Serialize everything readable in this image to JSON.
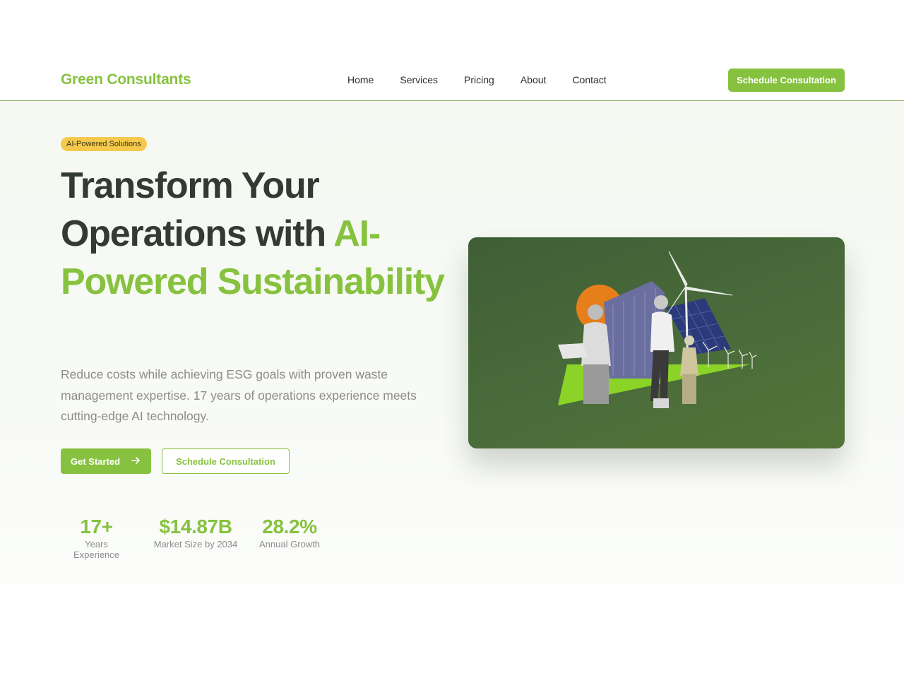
{
  "header": {
    "brand": "Green Consultants",
    "nav": [
      "Home",
      "Services",
      "Pricing",
      "About",
      "Contact"
    ],
    "cta": "Schedule Consultation"
  },
  "hero": {
    "badge": "AI-Powered Solutions",
    "headline_dark": "Transform Your Operations with ",
    "headline_accent": "AI-Powered Sustainability",
    "subtext": "Reduce costs while achieving ESG goals with proven waste management expertise. 17 years of operations experience meets cutting-edge AI technology.",
    "primary_button": "Get Started",
    "secondary_button": "Schedule Consultation",
    "stats": [
      {
        "value": "17+",
        "label": "Years Experience"
      },
      {
        "value": "$14.87B",
        "label": "Market Size by 2034"
      },
      {
        "value": "28.2%",
        "label": "Annual Growth"
      }
    ]
  },
  "colors": {
    "accent": "#86c23f",
    "badge": "#f4c94c",
    "heading": "#333a33",
    "muted": "#8c8c8c",
    "card": "#4a6c3a"
  },
  "icons": {
    "primary_button_icon": "arrow-right-icon"
  }
}
